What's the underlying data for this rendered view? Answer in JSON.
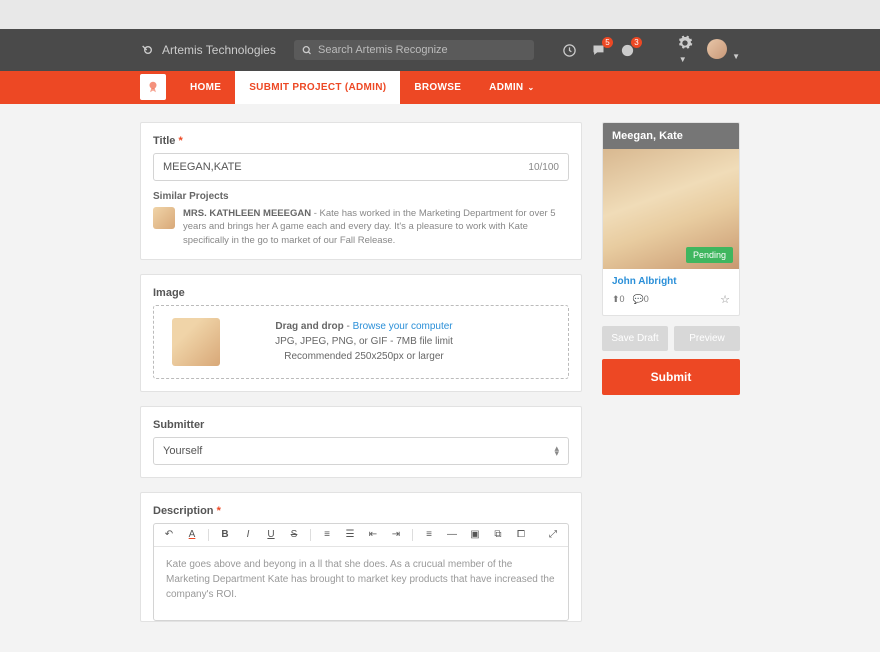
{
  "header": {
    "brand": "Artemis Technologies",
    "search_placeholder": "Search Artemis Recognize",
    "badges": {
      "chat": "5",
      "globe": "3"
    }
  },
  "nav": {
    "items": [
      "HOME",
      "SUBMIT PROJECT (ADMIN)",
      "BROWSE",
      "ADMIN"
    ],
    "active_index": 1
  },
  "form": {
    "title_label": "Title",
    "title_value": "MEEGAN,KATE",
    "title_counter": "10/100",
    "similar_label": "Similar Projects",
    "similar_name": "MRS. KATHLEEN MEEEGAN",
    "similar_text": " - Kate has worked in the Marketing Department for over 5 years and brings her A game each and every day. It's a pleasure to work with Kate specifically in the go to market of our Fall Release.",
    "image_label": "Image",
    "dz_bold": "Drag and drop",
    "dz_sep": " - ",
    "dz_link": "Browse your computer",
    "dz_l2": "JPG, JPEG, PNG, or GIF - 7MB file limit",
    "dz_l3": "Recommended 250x250px or larger",
    "submitter_label": "Submitter",
    "submitter_value": "Yourself",
    "description_label": "Description",
    "description_value": "Kate goes above and beyong in a ll that she does. As a crucual member of the Marketing Department Kate has brought to market key products that have increased the company's ROI."
  },
  "preview": {
    "head": "Meegan, Kate",
    "status": "Pending",
    "name": "John Albright",
    "up": "0",
    "comments": "0"
  },
  "side_buttons": {
    "draft": "Save Draft",
    "preview": "Preview",
    "submit": "Submit"
  }
}
